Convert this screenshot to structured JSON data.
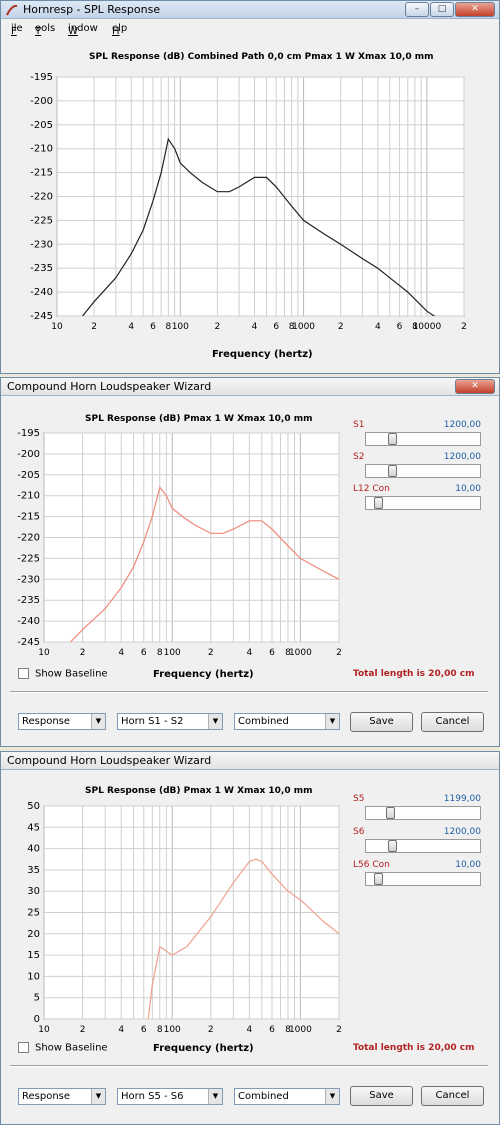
{
  "win1": {
    "title": "Hornresp - SPL Response",
    "menu": [
      "File",
      "Tools",
      "Window",
      "Help"
    ],
    "chart_title": "SPL Response (dB)    Combined    Path 0,0 cm    Pmax 1 W    Xmax 10,0 mm",
    "xlabel": "Frequency (hertz)"
  },
  "win2": {
    "title": "Compound Horn Loudspeaker Wizard",
    "chart_title": "SPL Response (dB)    Pmax 1 W    Xmax 10,0 mm",
    "sliders": [
      {
        "label": "S1",
        "value": "1200,00"
      },
      {
        "label": "S2",
        "value": "1200,00"
      },
      {
        "label": "L12 Con",
        "value": "10,00"
      }
    ],
    "show_baseline": "Show Baseline",
    "xlabel": "Frequency (hertz)",
    "total_length": "Total length is 20,00 cm",
    "combo_response": "Response",
    "combo_horn": "Horn S1 - S2",
    "combo_combined": "Combined",
    "save": "Save",
    "cancel": "Cancel"
  },
  "win3": {
    "title": "Compound Horn Loudspeaker Wizard",
    "chart_title": "SPL Response (dB)    Pmax 1 W    Xmax 10,0 mm",
    "sliders": [
      {
        "label": "S5",
        "value": "1199,00"
      },
      {
        "label": "S6",
        "value": "1200,00"
      },
      {
        "label": "L56 Con",
        "value": "10,00"
      }
    ],
    "show_baseline": "Show Baseline",
    "xlabel": "Frequency (hertz)",
    "total_length": "Total length is 20,00 cm",
    "combo_response": "Response",
    "combo_horn": "Horn S5 - S6",
    "combo_combined": "Combined",
    "save": "Save",
    "cancel": "Cancel"
  },
  "colors": {
    "curve1": "#222222",
    "curve2": "#f08878",
    "curve3": "#f0a090",
    "grid": "#cfcfcf"
  },
  "chart_data": [
    {
      "type": "line",
      "x_scale": "log",
      "xlim": [
        10,
        20000
      ],
      "ylim": [
        -245,
        -195
      ],
      "yticks": [
        -195,
        -200,
        -205,
        -210,
        -215,
        -220,
        -225,
        -230,
        -235,
        -240,
        -245
      ],
      "xtick_labels": [
        "10",
        "2",
        "4",
        "6",
        "8",
        "100",
        "2",
        "4",
        "6",
        "8",
        "1000",
        "2",
        "4",
        "6",
        "8",
        "10000",
        "2"
      ],
      "x": [
        10,
        15,
        20,
        30,
        40,
        50,
        60,
        70,
        80,
        90,
        100,
        120,
        150,
        200,
        250,
        300,
        400,
        500,
        600,
        800,
        1000,
        1500,
        2000,
        3000,
        4000,
        5000,
        7000,
        10000,
        15000,
        20000
      ],
      "y": [
        -250,
        -246,
        -242,
        -237,
        -232,
        -227,
        -221,
        -215,
        -208,
        -210,
        -213,
        -215,
        -217,
        -219,
        -219,
        -218,
        -216,
        -216,
        -218,
        -222,
        -225,
        -228,
        -230,
        -233,
        -235,
        -237,
        -240,
        -244,
        -247,
        -249
      ],
      "grid": true
    },
    {
      "type": "line",
      "x_scale": "log",
      "xlim": [
        10,
        2000
      ],
      "ylim": [
        -245,
        -195
      ],
      "yticks": [
        -195,
        -200,
        -205,
        -210,
        -215,
        -220,
        -225,
        -230,
        -235,
        -240,
        -245
      ],
      "xtick_labels": [
        "10",
        "2",
        "4",
        "6",
        "8",
        "100",
        "2",
        "4",
        "6",
        "8",
        "1000",
        "2"
      ],
      "x": [
        10,
        15,
        20,
        30,
        40,
        50,
        60,
        70,
        80,
        90,
        100,
        120,
        150,
        200,
        250,
        300,
        400,
        500,
        600,
        800,
        1000,
        1500,
        2000
      ],
      "y": [
        -250,
        -246,
        -242,
        -237,
        -232,
        -227,
        -221,
        -215,
        -208,
        -210,
        -213,
        -215,
        -217,
        -219,
        -219,
        -218,
        -216,
        -216,
        -218,
        -222,
        -225,
        -228,
        -230
      ],
      "grid": true
    },
    {
      "type": "line",
      "x_scale": "log",
      "xlim": [
        10,
        2000
      ],
      "ylim": [
        0,
        50
      ],
      "yticks": [
        0,
        5,
        10,
        15,
        20,
        25,
        30,
        35,
        40,
        45,
        50
      ],
      "xtick_labels": [
        "10",
        "2",
        "4",
        "6",
        "8",
        "100",
        "2",
        "4",
        "6",
        "8",
        "1000",
        "2"
      ],
      "x": [
        65,
        70,
        80,
        100,
        130,
        200,
        300,
        400,
        450,
        500,
        600,
        800,
        1000,
        1500,
        2000
      ],
      "y": [
        0,
        8,
        17,
        15,
        17,
        24,
        32,
        37,
        37.5,
        37,
        34,
        30,
        28,
        23,
        20
      ],
      "grid": true
    }
  ]
}
